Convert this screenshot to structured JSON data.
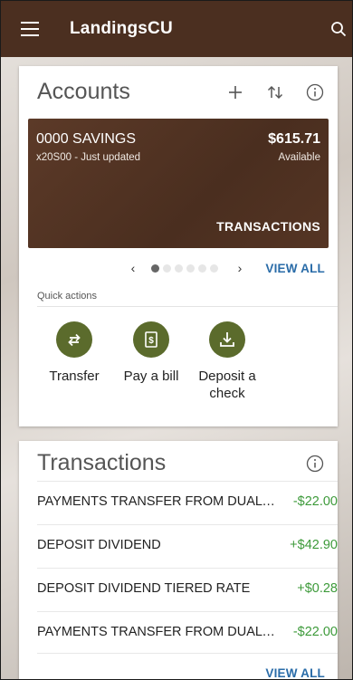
{
  "app": {
    "title": "LandingsCU"
  },
  "accounts": {
    "header": "Accounts",
    "account": {
      "name": "0000 SAVINGS",
      "subtitle": "x20S00 - Just updated",
      "balance": "$615.71",
      "balance_label": "Available",
      "transactions_link": "TRANSACTIONS"
    },
    "pager": {
      "prev": "‹",
      "next": "›",
      "total_pages": 6,
      "current_page": 1
    },
    "view_all": "VIEW ALL"
  },
  "quick_actions": {
    "label": "Quick actions",
    "items": [
      {
        "label": "Transfer",
        "icon": "transfer-icon"
      },
      {
        "label": "Pay a bill",
        "icon": "receipt-icon"
      },
      {
        "label": "Deposit a check",
        "icon": "download-icon"
      }
    ]
  },
  "transactions": {
    "header": "Transactions",
    "items": [
      {
        "desc": "PAYMENTS TRANSFER FROM DUAL AUTO",
        "amount": "-$22.00"
      },
      {
        "desc": "DEPOSIT DIVIDEND",
        "amount": "+$42.90"
      },
      {
        "desc": "DEPOSIT DIVIDEND TIERED RATE",
        "amount": "+$0.28"
      },
      {
        "desc": "PAYMENTS TRANSFER FROM DUAL AUTO",
        "amount": "-$22.00"
      }
    ],
    "view_all": "VIEW ALL"
  },
  "colors": {
    "header_bg": "#4b2f20",
    "account_tile": "#4e3120",
    "action_green": "#5b6b2c",
    "amount_green": "#3d9a3a",
    "link_blue": "#2a6ca8"
  }
}
